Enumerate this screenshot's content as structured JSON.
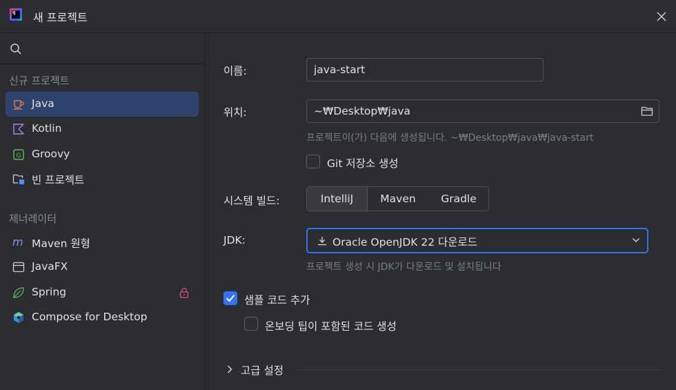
{
  "window": {
    "title": "새 프로젝트"
  },
  "sidebar": {
    "search_placeholder": "",
    "sections": [
      {
        "header": "신규 프로젝트"
      },
      {
        "header": "제너레이터"
      }
    ],
    "new_project_items": [
      {
        "label": "Java",
        "icon": "java-cup-icon",
        "selected": true
      },
      {
        "label": "Kotlin",
        "icon": "kotlin-icon"
      },
      {
        "label": "Groovy",
        "icon": "groovy-icon"
      },
      {
        "label": "빈 프로젝트",
        "icon": "empty-project-icon"
      }
    ],
    "generator_items": [
      {
        "label": "Maven 원형",
        "icon": "maven-icon"
      },
      {
        "label": "JavaFX",
        "icon": "javafx-window-icon"
      },
      {
        "label": "Spring",
        "icon": "spring-leaf-icon",
        "locked": true
      },
      {
        "label": "Compose for Desktop",
        "icon": "compose-icon"
      }
    ]
  },
  "form": {
    "name_label": "이름:",
    "name_value": "java-start",
    "location_label": "위치:",
    "location_value": "~₩Desktop₩java",
    "location_hint": "프로젝트이(가) 다음에 생성됩니다. ~₩Desktop₩java₩java-start",
    "git_label": "Git 저장소 생성",
    "git_checked": false,
    "build_label": "시스템 빌드:",
    "build_options": [
      "IntelliJ",
      "Maven",
      "Gradle"
    ],
    "build_selected": "IntelliJ",
    "jdk_label": "JDK:",
    "jdk_value": "Oracle OpenJDK 22 다운로드",
    "jdk_hint": "프로젝트 생성 시 JDK가 다운로드 및 설치됩니다",
    "sample_code_label": "샘플 코드 추가",
    "sample_code_checked": true,
    "onboarding_label": "온보딩 팁이 포함된 코드 생성",
    "onboarding_checked": false,
    "advanced_label": "고급 설정"
  },
  "colors": {
    "background": "#2b2d30",
    "selection": "#2e436e",
    "accent": "#3574f0",
    "muted_text": "#7a7e85"
  }
}
